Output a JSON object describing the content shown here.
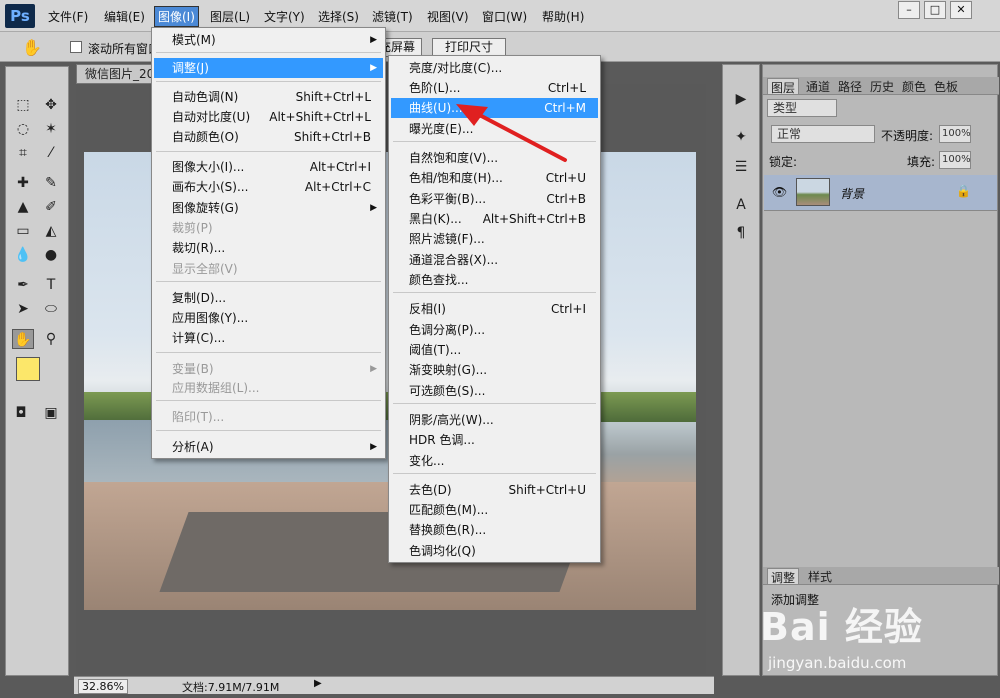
{
  "app": {
    "logo": "Ps",
    "window_controls": [
      "–",
      "□",
      "✕"
    ]
  },
  "menubar": [
    "文件(F)",
    "编辑(E)",
    "图像(I)",
    "图层(L)",
    "文字(Y)",
    "选择(S)",
    "滤镜(T)",
    "视图(V)",
    "窗口(W)",
    "帮助(H)"
  ],
  "options": {
    "scroll_all": "滚动所有窗口",
    "fill_screen": "填充屏幕",
    "print_size": "打印尺寸"
  },
  "document": {
    "tab": "微信图片_20",
    "zoom": "32.86%",
    "docsize": "文档:7.91M/7.91M"
  },
  "image_menu": [
    {
      "label": "模式(M)",
      "sub": true
    },
    {
      "label": "调整(J)",
      "sub": true,
      "hl": true
    },
    {
      "label": "自动色调(N)",
      "sc": "Shift+Ctrl+L"
    },
    {
      "label": "自动对比度(U)",
      "sc": "Alt+Shift+Ctrl+L"
    },
    {
      "label": "自动颜色(O)",
      "sc": "Shift+Ctrl+B"
    },
    {
      "label": "图像大小(I)...",
      "sc": "Alt+Ctrl+I"
    },
    {
      "label": "画布大小(S)...",
      "sc": "Alt+Ctrl+C"
    },
    {
      "label": "图像旋转(G)",
      "sub": true
    },
    {
      "label": "裁剪(P)",
      "dis": true
    },
    {
      "label": "裁切(R)..."
    },
    {
      "label": "显示全部(V)",
      "dis": true
    },
    {
      "label": "复制(D)..."
    },
    {
      "label": "应用图像(Y)..."
    },
    {
      "label": "计算(C)..."
    },
    {
      "label": "变量(B)",
      "sub": true,
      "dis": true
    },
    {
      "label": "应用数据组(L)...",
      "dis": true
    },
    {
      "label": "陷印(T)...",
      "dis": true
    },
    {
      "label": "分析(A)",
      "sub": true
    }
  ],
  "adjust_menu": [
    {
      "label": "亮度/对比度(C)..."
    },
    {
      "label": "色阶(L)...",
      "sc": "Ctrl+L"
    },
    {
      "label": "曲线(U)...",
      "sc": "Ctrl+M",
      "hl": true
    },
    {
      "label": "曝光度(E)..."
    },
    {
      "label": "自然饱和度(V)..."
    },
    {
      "label": "色相/饱和度(H)...",
      "sc": "Ctrl+U"
    },
    {
      "label": "色彩平衡(B)...",
      "sc": "Ctrl+B"
    },
    {
      "label": "黑白(K)...",
      "sc": "Alt+Shift+Ctrl+B"
    },
    {
      "label": "照片滤镜(F)..."
    },
    {
      "label": "通道混合器(X)..."
    },
    {
      "label": "颜色查找..."
    },
    {
      "label": "反相(I)",
      "sc": "Ctrl+I"
    },
    {
      "label": "色调分离(P)..."
    },
    {
      "label": "阈值(T)..."
    },
    {
      "label": "渐变映射(G)..."
    },
    {
      "label": "可选颜色(S)..."
    },
    {
      "label": "阴影/高光(W)..."
    },
    {
      "label": "HDR 色调..."
    },
    {
      "label": "变化..."
    },
    {
      "label": "去色(D)",
      "sc": "Shift+Ctrl+U"
    },
    {
      "label": "匹配颜色(M)..."
    },
    {
      "label": "替换颜色(R)..."
    },
    {
      "label": "色调均化(Q)"
    }
  ],
  "layers_panel": {
    "tabs": [
      "图层",
      "通道",
      "路径",
      "历史",
      "颜色",
      "色板"
    ],
    "kind": "类型",
    "blend": "正常",
    "opacity_label": "不透明度:",
    "opacity": "100%",
    "lock_label": "锁定:",
    "fill_label": "填充:",
    "fill": "100%",
    "layer_name": "背景"
  },
  "adjust_panel": {
    "tabs": [
      "调整",
      "样式"
    ],
    "title": "添加调整"
  },
  "watermark": {
    "brand": "Bai 经验",
    "url": "jingyan.baidu.com"
  }
}
